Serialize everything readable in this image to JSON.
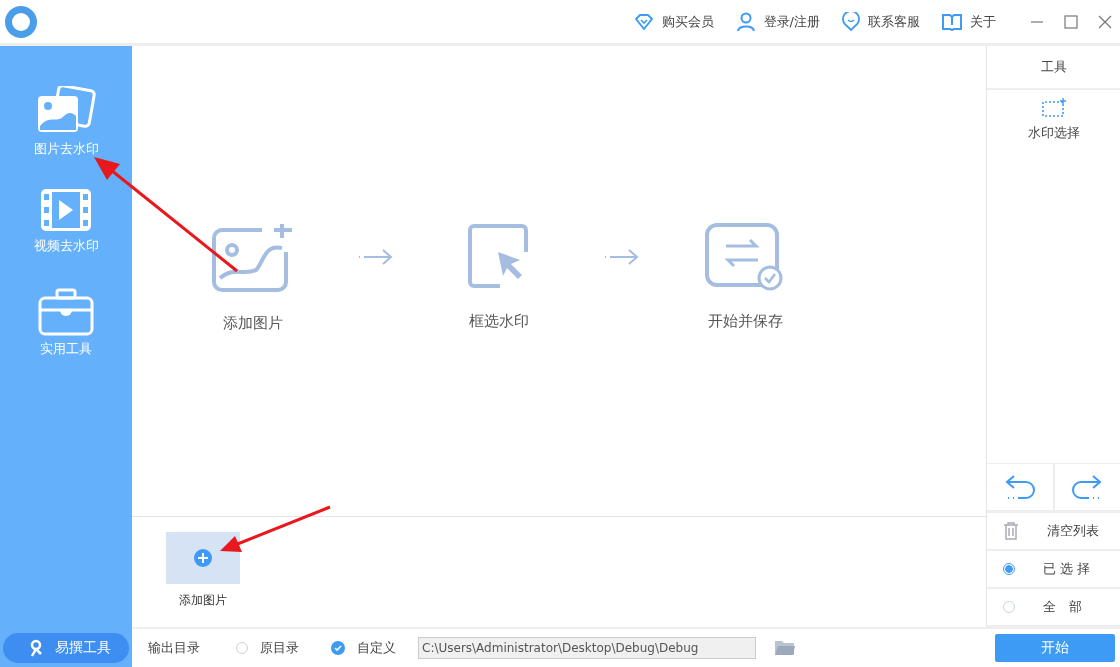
{
  "topbar": {
    "actions": [
      {
        "kind": "diamond",
        "label": "购买会员"
      },
      {
        "kind": "user",
        "label": "登录/注册"
      },
      {
        "kind": "chat",
        "label": "联系客服"
      },
      {
        "kind": "book",
        "label": "关于"
      }
    ]
  },
  "sidebar": {
    "items": [
      {
        "kind": "image",
        "label": "图片去水印"
      },
      {
        "kind": "video",
        "label": "视频去水印"
      },
      {
        "kind": "toolbox",
        "label": "实用工具"
      }
    ],
    "promo": "易撰工具"
  },
  "steps": [
    {
      "kind": "add",
      "label": "添加图片"
    },
    {
      "kind": "select",
      "label": "框选水印"
    },
    {
      "kind": "save",
      "label": "开始并保存"
    }
  ],
  "add_tile": {
    "label": "添加图片"
  },
  "tools": {
    "title": "工具",
    "items": [
      {
        "label": "水印选择"
      }
    ],
    "clear": "清空列表",
    "scope": [
      {
        "label": "已 选 择",
        "selected": true
      },
      {
        "label": "全　部",
        "selected": false
      }
    ]
  },
  "output": {
    "label": "输出目录",
    "options": [
      {
        "label": "原目录",
        "selected": false
      },
      {
        "label": "自定义",
        "selected": true
      }
    ],
    "path": "C:\\Users\\Administrator\\Desktop\\Debug\\Debug"
  },
  "start_button": "开始"
}
